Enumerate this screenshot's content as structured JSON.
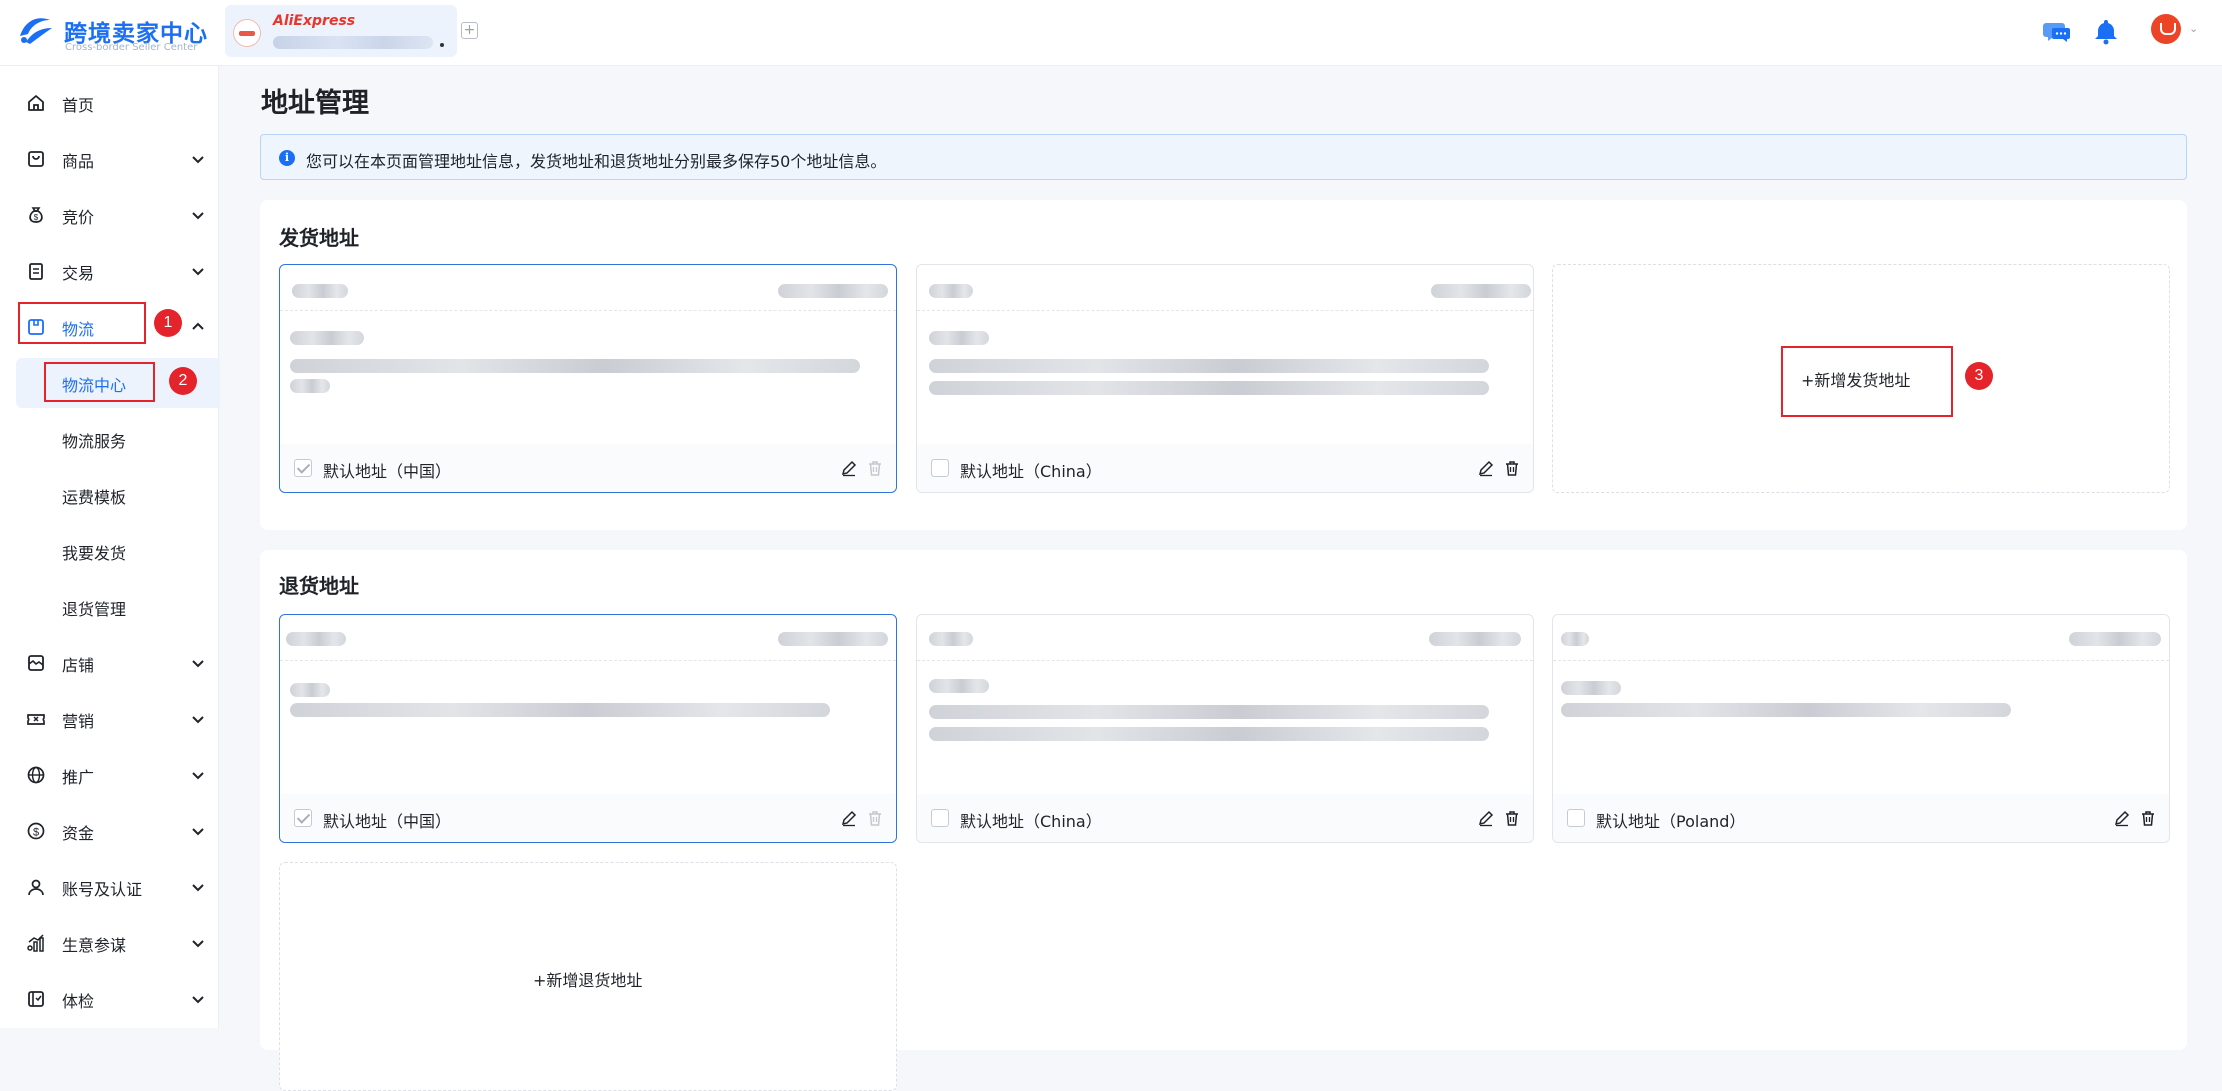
{
  "app": {
    "title": "跨境卖家中心",
    "subtitle": "Cross-border Seller Center",
    "store_brand": "AliExpress"
  },
  "sidebar": {
    "items": [
      {
        "label": "首页",
        "icon": "home-icon"
      },
      {
        "label": "商品",
        "icon": "bag-icon"
      },
      {
        "label": "竞价",
        "icon": "moneybag-icon"
      },
      {
        "label": "交易",
        "icon": "clipboard-icon"
      },
      {
        "label": "物流",
        "icon": "box-icon"
      },
      {
        "label": "店铺",
        "icon": "shop-icon"
      },
      {
        "label": "营销",
        "icon": "ticket-icon"
      },
      {
        "label": "推广",
        "icon": "globe-icon"
      },
      {
        "label": "资金",
        "icon": "dollar-icon"
      },
      {
        "label": "账号及认证",
        "icon": "person-icon"
      },
      {
        "label": "生意参谋",
        "icon": "analytics-icon"
      },
      {
        "label": "体检",
        "icon": "checkup-icon"
      }
    ],
    "logistics_sub": [
      {
        "label": "物流中心"
      },
      {
        "label": "物流服务"
      },
      {
        "label": "运费模板"
      },
      {
        "label": "我要发货"
      },
      {
        "label": "退货管理"
      }
    ],
    "active": "物流",
    "selected_sub": "物流中心"
  },
  "annotations": [
    "1",
    "2",
    "3"
  ],
  "main": {
    "title": "地址管理",
    "notice": "您可以在本页面管理地址信息，发货地址和退货地址分别最多保存50个地址信息。",
    "shipping": {
      "title": "发货地址",
      "cards": [
        {
          "default_label": "默认地址（中国）",
          "checked": true
        },
        {
          "default_label": "默认地址（China）",
          "checked": false
        }
      ],
      "add_label": "+新增发货地址"
    },
    "returns": {
      "title": "退货地址",
      "cards": [
        {
          "default_label": "默认地址（中国）",
          "checked": true
        },
        {
          "default_label": "默认地址（China）",
          "checked": false
        },
        {
          "default_label": "默认地址（Poland）",
          "checked": false
        }
      ],
      "add_label": "+新增退货地址"
    }
  },
  "colors": {
    "accent": "#1b6ff5",
    "annotation": "#e4232a"
  }
}
